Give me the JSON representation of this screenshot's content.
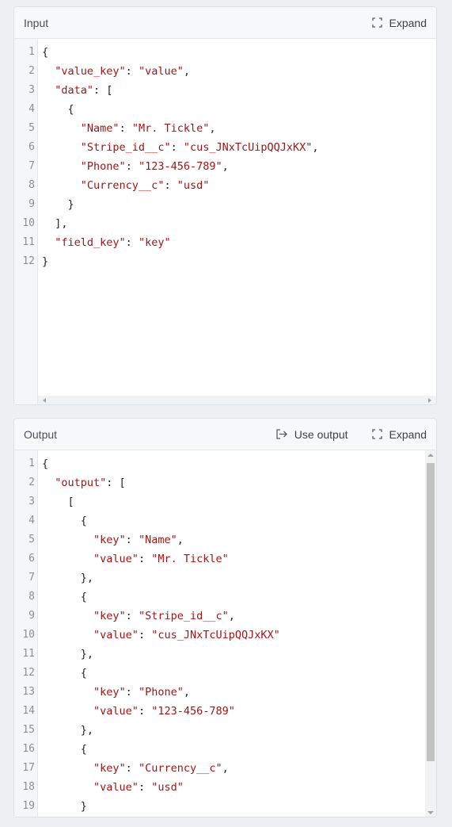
{
  "input_panel": {
    "title": "Input",
    "expand_label": "Expand",
    "lines": [
      [
        {
          "t": "p",
          "v": "{"
        }
      ],
      [
        {
          "t": "p",
          "v": "  "
        },
        {
          "t": "k",
          "v": "\"value_key\""
        },
        {
          "t": "p",
          "v": ": "
        },
        {
          "t": "s",
          "v": "\"value\""
        },
        {
          "t": "p",
          "v": ","
        }
      ],
      [
        {
          "t": "p",
          "v": "  "
        },
        {
          "t": "k",
          "v": "\"data\""
        },
        {
          "t": "p",
          "v": ": ["
        }
      ],
      [
        {
          "t": "p",
          "v": "    {"
        }
      ],
      [
        {
          "t": "p",
          "v": "      "
        },
        {
          "t": "k",
          "v": "\"Name\""
        },
        {
          "t": "p",
          "v": ": "
        },
        {
          "t": "s",
          "v": "\"Mr. Tickle\""
        },
        {
          "t": "p",
          "v": ","
        }
      ],
      [
        {
          "t": "p",
          "v": "      "
        },
        {
          "t": "k",
          "v": "\"Stripe_id__c\""
        },
        {
          "t": "p",
          "v": ": "
        },
        {
          "t": "s",
          "v": "\"cus_JNxTcUipQQJxKX\""
        },
        {
          "t": "p",
          "v": ","
        }
      ],
      [
        {
          "t": "p",
          "v": "      "
        },
        {
          "t": "k",
          "v": "\"Phone\""
        },
        {
          "t": "p",
          "v": ": "
        },
        {
          "t": "s",
          "v": "\"123-456-789\""
        },
        {
          "t": "p",
          "v": ","
        }
      ],
      [
        {
          "t": "p",
          "v": "      "
        },
        {
          "t": "k",
          "v": "\"Currency__c\""
        },
        {
          "t": "p",
          "v": ": "
        },
        {
          "t": "s",
          "v": "\"usd\""
        }
      ],
      [
        {
          "t": "p",
          "v": "    }"
        }
      ],
      [
        {
          "t": "p",
          "v": "  ],"
        }
      ],
      [
        {
          "t": "p",
          "v": "  "
        },
        {
          "t": "k",
          "v": "\"field_key\""
        },
        {
          "t": "p",
          "v": ": "
        },
        {
          "t": "s",
          "v": "\"key\""
        }
      ],
      [
        {
          "t": "p",
          "v": "}"
        }
      ]
    ]
  },
  "output_panel": {
    "title": "Output",
    "use_output_label": "Use output",
    "expand_label": "Expand",
    "lines": [
      [
        {
          "t": "p",
          "v": "{"
        }
      ],
      [
        {
          "t": "p",
          "v": "  "
        },
        {
          "t": "k",
          "v": "\"output\""
        },
        {
          "t": "p",
          "v": ": ["
        }
      ],
      [
        {
          "t": "p",
          "v": "    ["
        }
      ],
      [
        {
          "t": "p",
          "v": "      {"
        }
      ],
      [
        {
          "t": "p",
          "v": "        "
        },
        {
          "t": "k",
          "v": "\"key\""
        },
        {
          "t": "p",
          "v": ": "
        },
        {
          "t": "s",
          "v": "\"Name\""
        },
        {
          "t": "p",
          "v": ","
        }
      ],
      [
        {
          "t": "p",
          "v": "        "
        },
        {
          "t": "k",
          "v": "\"value\""
        },
        {
          "t": "p",
          "v": ": "
        },
        {
          "t": "s",
          "v": "\"Mr. Tickle\""
        }
      ],
      [
        {
          "t": "p",
          "v": "      },"
        }
      ],
      [
        {
          "t": "p",
          "v": "      {"
        }
      ],
      [
        {
          "t": "p",
          "v": "        "
        },
        {
          "t": "k",
          "v": "\"key\""
        },
        {
          "t": "p",
          "v": ": "
        },
        {
          "t": "s",
          "v": "\"Stripe_id__c\""
        },
        {
          "t": "p",
          "v": ","
        }
      ],
      [
        {
          "t": "p",
          "v": "        "
        },
        {
          "t": "k",
          "v": "\"value\""
        },
        {
          "t": "p",
          "v": ": "
        },
        {
          "t": "s",
          "v": "\"cus_JNxTcUipQQJxKX\""
        }
      ],
      [
        {
          "t": "p",
          "v": "      },"
        }
      ],
      [
        {
          "t": "p",
          "v": "      {"
        }
      ],
      [
        {
          "t": "p",
          "v": "        "
        },
        {
          "t": "k",
          "v": "\"key\""
        },
        {
          "t": "p",
          "v": ": "
        },
        {
          "t": "s",
          "v": "\"Phone\""
        },
        {
          "t": "p",
          "v": ","
        }
      ],
      [
        {
          "t": "p",
          "v": "        "
        },
        {
          "t": "k",
          "v": "\"value\""
        },
        {
          "t": "p",
          "v": ": "
        },
        {
          "t": "s",
          "v": "\"123-456-789\""
        }
      ],
      [
        {
          "t": "p",
          "v": "      },"
        }
      ],
      [
        {
          "t": "p",
          "v": "      {"
        }
      ],
      [
        {
          "t": "p",
          "v": "        "
        },
        {
          "t": "k",
          "v": "\"key\""
        },
        {
          "t": "p",
          "v": ": "
        },
        {
          "t": "s",
          "v": "\"Currency__c\""
        },
        {
          "t": "p",
          "v": ","
        }
      ],
      [
        {
          "t": "p",
          "v": "        "
        },
        {
          "t": "k",
          "v": "\"value\""
        },
        {
          "t": "p",
          "v": ": "
        },
        {
          "t": "s",
          "v": "\"usd\""
        }
      ],
      [
        {
          "t": "p",
          "v": "      }"
        }
      ]
    ]
  },
  "colors": {
    "key": "#a31515",
    "string": "#a31515",
    "punct": "#1f2328",
    "line_number": "#8b9098"
  },
  "icons": {
    "expand": "expand-corners-icon",
    "use_output": "arrow-right-bracket-icon"
  }
}
